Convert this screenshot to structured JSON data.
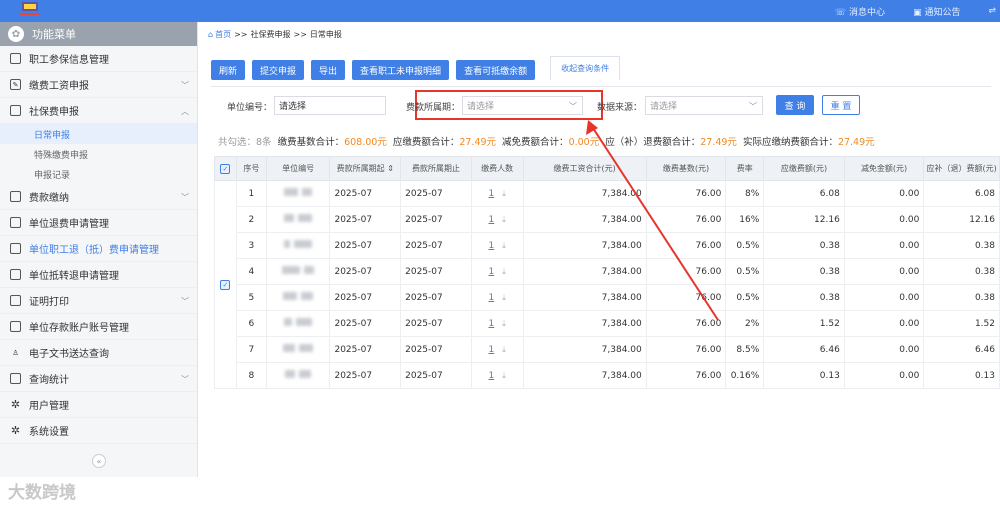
{
  "header": {
    "messages_label": "消息中心",
    "notices_label": "通知公告"
  },
  "sidebar": {
    "title": "功能菜单",
    "items": [
      {
        "label": "职工参保信息管理",
        "expandable": false
      },
      {
        "label": "缴费工资申报",
        "expandable": true
      },
      {
        "label": "社保费申报",
        "expandable": true,
        "expanded": true
      },
      {
        "label": "费款缴纳",
        "expandable": true
      },
      {
        "label": "单位退费申请管理",
        "expandable": false
      },
      {
        "label": "单位职工退（抵）费申请管理",
        "expandable": false
      },
      {
        "label": "单位抵转退申请管理",
        "expandable": false
      },
      {
        "label": "证明打印",
        "expandable": true
      },
      {
        "label": "单位存款账户账号管理",
        "expandable": false
      },
      {
        "label": "电子文书送达查询",
        "expandable": false
      },
      {
        "label": "查询统计",
        "expandable": true
      },
      {
        "label": "用户管理",
        "expandable": false
      },
      {
        "label": "系统设置",
        "expandable": false
      }
    ],
    "subitems": [
      "日常申报",
      "特殊缴费申报",
      "申报记录"
    ]
  },
  "breadcrumb": [
    "首页",
    "社保费申报",
    "日常申报"
  ],
  "breadcrumb_sep": ">>",
  "toolbar": {
    "refresh": "刷新",
    "submit": "提交申报",
    "export": "导出",
    "view_unreported": "查看职工未申报明细",
    "view_offset_balance": "查看可抵缴余额",
    "collapse_query": "收起查询条件"
  },
  "filter": {
    "unit_code_label": "单位编号：",
    "unit_code_placeholder": "请选择",
    "period_label": "费款所属期：",
    "period_placeholder": "请选择",
    "source_label": "数据来源：",
    "source_placeholder": "请选择",
    "query_button": "查 询",
    "reset_button": "重 置"
  },
  "summary": {
    "selected_label": "共勾选：",
    "selected_count": "8条",
    "base_total_label": "缴费基数合计：",
    "base_total": "608.00元",
    "payable_total_label": "应缴费额合计：",
    "payable_total": "27.49元",
    "reduction_total_label": "减免费额合计：",
    "reduction_total": "0.00元",
    "refund_total_label": "应（补）退费额合计：",
    "refund_total": "27.49元",
    "actual_total_label": "实际应缴纳费额合计：",
    "actual_total": "27.49元"
  },
  "table": {
    "columns": [
      "序号",
      "单位编号",
      "费款所属期起",
      "费款所属期止",
      "缴费人数",
      "缴费工资合计(元)",
      "缴费基数(元)",
      "费率",
      "应缴费额(元)",
      "减免金额(元)",
      "应补（退）费额(元)"
    ],
    "rows": [
      {
        "no": "1",
        "start": "2025-07",
        "end": "2025-07",
        "count": "1",
        "wage": "7,384.00",
        "base": "76.00",
        "rate": "8%",
        "payable": "6.08",
        "reduction": "0.00",
        "refund": "6.08"
      },
      {
        "no": "2",
        "start": "2025-07",
        "end": "2025-07",
        "count": "1",
        "wage": "7,384.00",
        "base": "76.00",
        "rate": "16%",
        "payable": "12.16",
        "reduction": "0.00",
        "refund": "12.16"
      },
      {
        "no": "3",
        "start": "2025-07",
        "end": "2025-07",
        "count": "1",
        "wage": "7,384.00",
        "base": "76.00",
        "rate": "0.5%",
        "payable": "0.38",
        "reduction": "0.00",
        "refund": "0.38"
      },
      {
        "no": "4",
        "start": "2025-07",
        "end": "2025-07",
        "count": "1",
        "wage": "7,384.00",
        "base": "76.00",
        "rate": "0.5%",
        "payable": "0.38",
        "reduction": "0.00",
        "refund": "0.38"
      },
      {
        "no": "5",
        "start": "2025-07",
        "end": "2025-07",
        "count": "1",
        "wage": "7,384.00",
        "base": "76.00",
        "rate": "0.5%",
        "payable": "0.38",
        "reduction": "0.00",
        "refund": "0.38"
      },
      {
        "no": "6",
        "start": "2025-07",
        "end": "2025-07",
        "count": "1",
        "wage": "7,384.00",
        "base": "76.00",
        "rate": "2%",
        "payable": "1.52",
        "reduction": "0.00",
        "refund": "1.52"
      },
      {
        "no": "7",
        "start": "2025-07",
        "end": "2025-07",
        "count": "1",
        "wage": "7,384.00",
        "base": "76.00",
        "rate": "8.5%",
        "payable": "6.46",
        "reduction": "0.00",
        "refund": "6.46"
      },
      {
        "no": "8",
        "start": "2025-07",
        "end": "2025-07",
        "count": "1",
        "wage": "7,384.00",
        "base": "76.00",
        "rate": "0.16%",
        "payable": "0.13",
        "reduction": "0.00",
        "refund": "0.13"
      }
    ]
  },
  "watermark": "大数跨境",
  "colors": {
    "primary": "#3f7fe6",
    "accent_orange": "#f08a24",
    "highlight_red": "#e6352b"
  }
}
